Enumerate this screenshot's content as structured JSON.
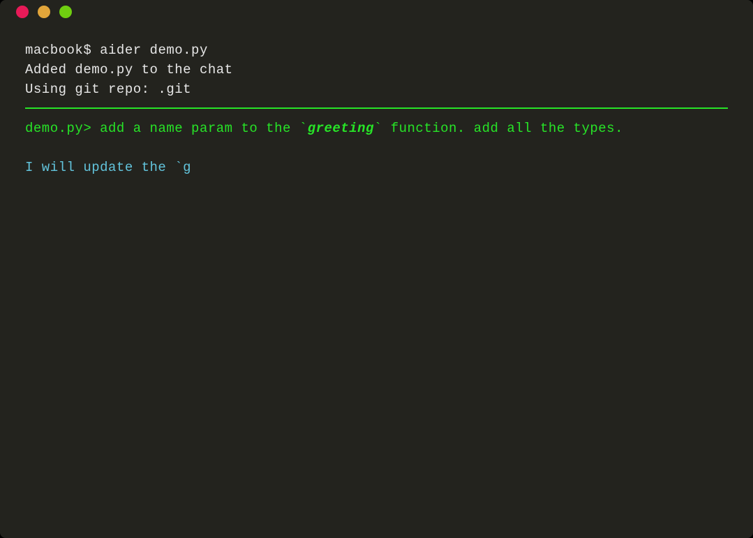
{
  "colors": {
    "bg": "#23231e",
    "white": "#e6e6e6",
    "green": "#27e427",
    "cyan": "#62c3db",
    "dot_red": "#e81a58",
    "dot_yellow": "#e2a53a",
    "dot_green": "#6fce10"
  },
  "titlebar": {
    "dots": [
      "red",
      "yellow",
      "green"
    ]
  },
  "lines": {
    "shell_prompt": "macbook$ ",
    "shell_command": "aider demo.py",
    "added_msg": "Added demo.py to the chat",
    "git_msg": "Using git repo: .git",
    "input_prompt": "demo.py> ",
    "input_text_before": "add a name param to the ",
    "input_backtick1": "`",
    "input_emphasis": "greeting",
    "input_backtick2": "`",
    "input_text_after": " function. add all the types.",
    "response_partial": "I will update the `g"
  }
}
